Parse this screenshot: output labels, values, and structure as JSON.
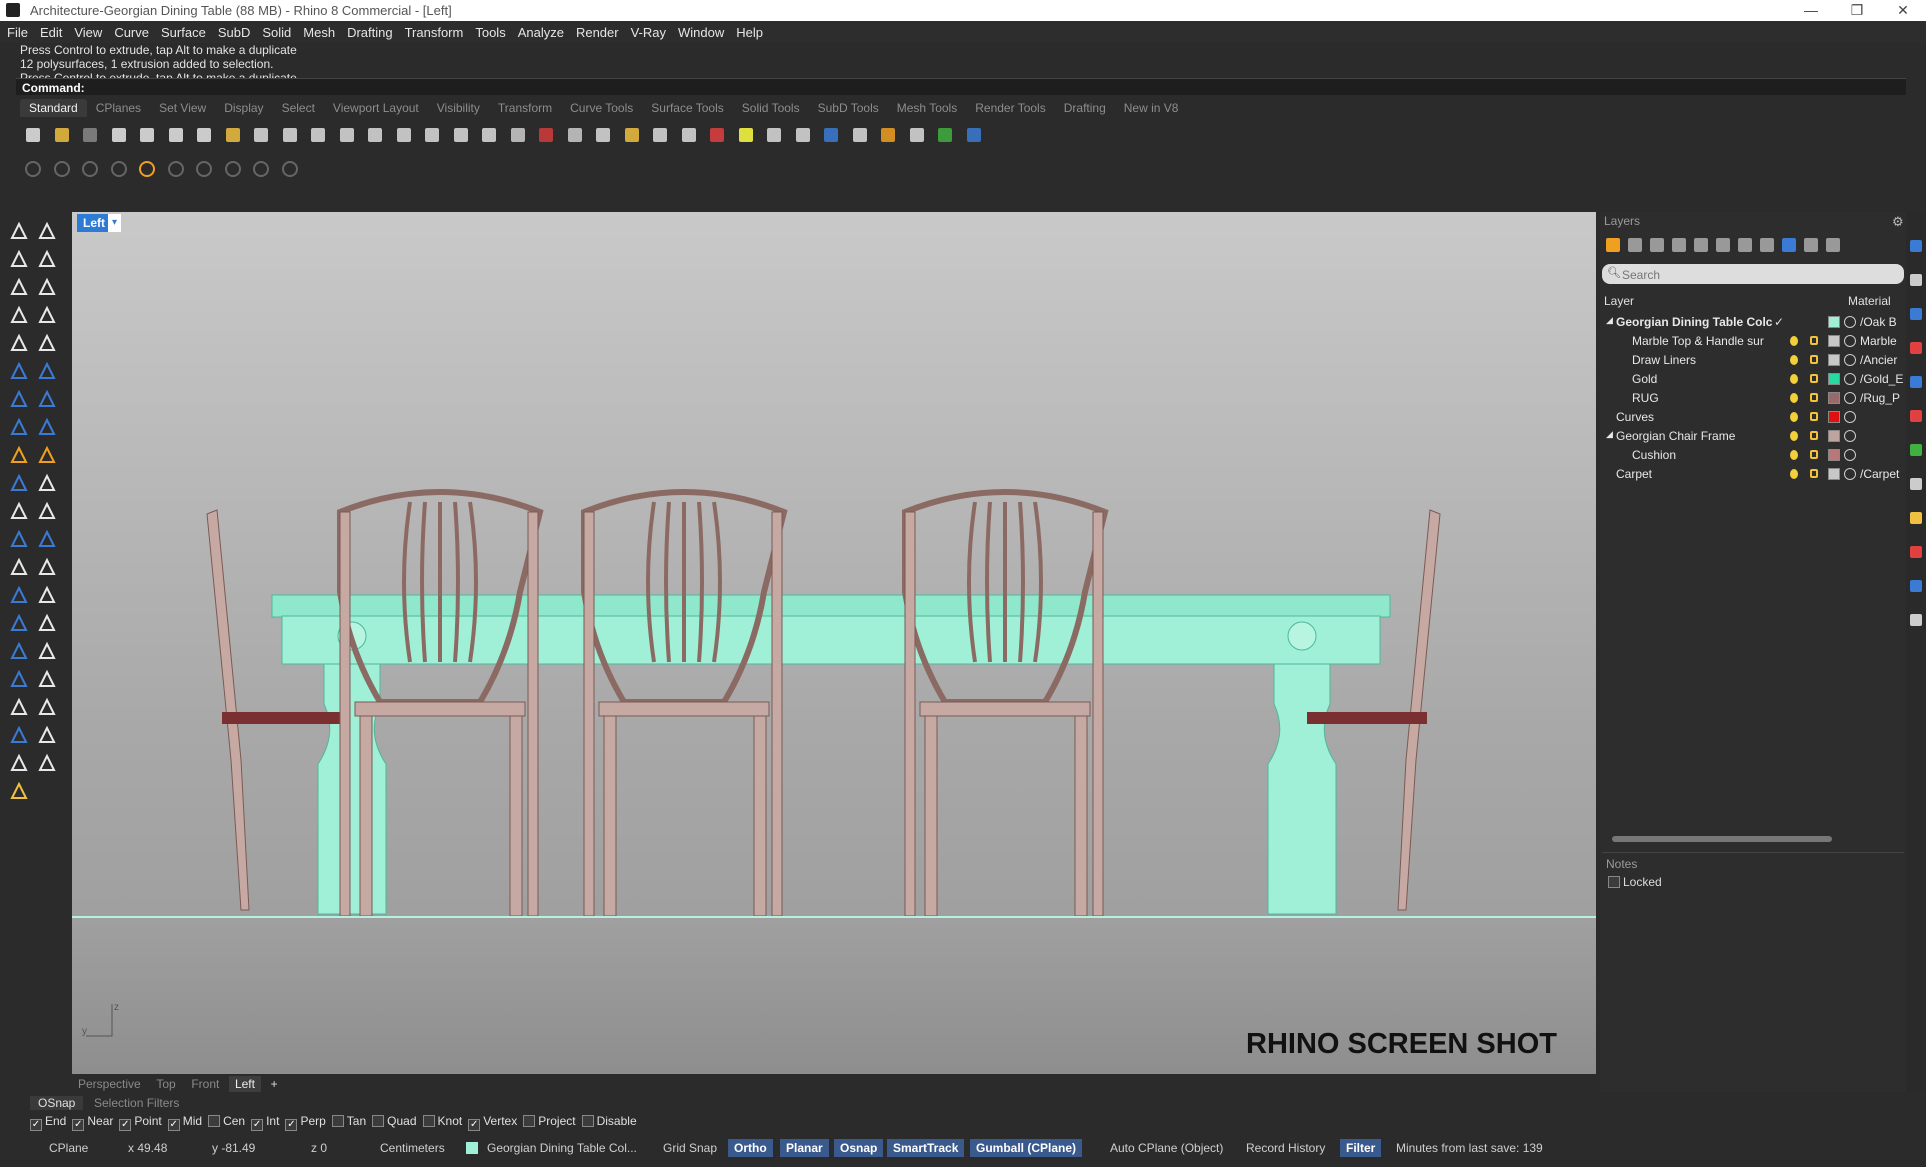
{
  "window": {
    "title": "Architecture-Georgian Dining Table (88 MB) - Rhino 8 Commercial - [Left]",
    "minimize": "—",
    "maximize": "❐",
    "close": "✕"
  },
  "menu": [
    "File",
    "Edit",
    "View",
    "Curve",
    "Surface",
    "SubD",
    "Solid",
    "Mesh",
    "Drafting",
    "Transform",
    "Tools",
    "Analyze",
    "Render",
    "V-Ray",
    "Window",
    "Help"
  ],
  "command": {
    "history": [
      "Press Control to extrude, tap Alt to make a duplicate",
      "12 polysurfaces, 1 extrusion added to selection.",
      "Press Control to extrude, tap Alt to make a duplicate"
    ],
    "prompt": "Command:",
    "value": ""
  },
  "toolbar_tabs": [
    "Standard",
    "CPlanes",
    "Set View",
    "Display",
    "Select",
    "Viewport Layout",
    "Visibility",
    "Transform",
    "Curve Tools",
    "Surface Tools",
    "Solid Tools",
    "SubD Tools",
    "Mesh Tools",
    "Render Tools",
    "Drafting",
    "New in V8"
  ],
  "viewport": {
    "name": "Left",
    "watermark": "RHINO SCREEN SHOT",
    "axis_z": "z",
    "axis_y": "y",
    "tabs": [
      "Perspective",
      "Top",
      "Front",
      "Left"
    ],
    "add": "+"
  },
  "layers_panel": {
    "title": "Layers",
    "search_placeholder": "Search",
    "col_layer": "Layer",
    "col_material": "Material",
    "rows": [
      {
        "name": "Georgian Dining Table Colc",
        "material": "/Oak B",
        "color": "#9ff0d6",
        "bold": true,
        "expanded": true,
        "indent": 0,
        "current": true
      },
      {
        "name": "Marble Top & Handle sur",
        "material": "Marble",
        "color": "#c8c8c8",
        "indent": 1
      },
      {
        "name": "Draw Liners",
        "material": "/Ancier",
        "color": "#c8c8c8",
        "indent": 1
      },
      {
        "name": "Gold",
        "material": "/Gold_E",
        "color": "#28d9a0",
        "indent": 1
      },
      {
        "name": "RUG",
        "material": "/Rug_P",
        "color": "#9a6a6a",
        "indent": 1
      },
      {
        "name": "Curves",
        "material": "",
        "color": "#e01010",
        "indent": 0
      },
      {
        "name": "Georgian Chair Frame",
        "material": "",
        "color": "#bfa39e",
        "expanded": true,
        "indent": 0
      },
      {
        "name": "Cushion",
        "material": "",
        "color": "#b97878",
        "indent": 1
      },
      {
        "name": "Carpet",
        "material": "/Carpet",
        "color": "#c8c8c8",
        "indent": 0
      }
    ]
  },
  "notes_panel": {
    "title": "Notes",
    "locked_label": "Locked"
  },
  "osnap": {
    "tab": "OSnap",
    "tab2": "Selection Filters",
    "items": [
      {
        "label": "End",
        "checked": true
      },
      {
        "label": "Near",
        "checked": true
      },
      {
        "label": "Point",
        "checked": true
      },
      {
        "label": "Mid",
        "checked": true
      },
      {
        "label": "Cen",
        "checked": false
      },
      {
        "label": "Int",
        "checked": true
      },
      {
        "label": "Perp",
        "checked": true
      },
      {
        "label": "Tan",
        "checked": false
      },
      {
        "label": "Quad",
        "checked": false
      },
      {
        "label": "Knot",
        "checked": false
      },
      {
        "label": "Vertex",
        "checked": true
      },
      {
        "label": "Project",
        "checked": false
      },
      {
        "label": "Disable",
        "checked": false
      }
    ]
  },
  "status": {
    "cplane": "CPlane",
    "x": "x 49.48",
    "y": "y -81.49",
    "z": "z 0",
    "units": "Centimeters",
    "layer": "Georgian Dining Table Col...",
    "grid_snap": "Grid Snap",
    "ortho": "Ortho",
    "planar": "Planar",
    "osnap": "Osnap",
    "smarttrack": "SmartTrack",
    "gumball": "Gumball (CPlane)",
    "autocplane": "Auto CPlane (Object)",
    "record": "Record History",
    "filter": "Filter",
    "minutes": "Minutes from last save: 139"
  }
}
